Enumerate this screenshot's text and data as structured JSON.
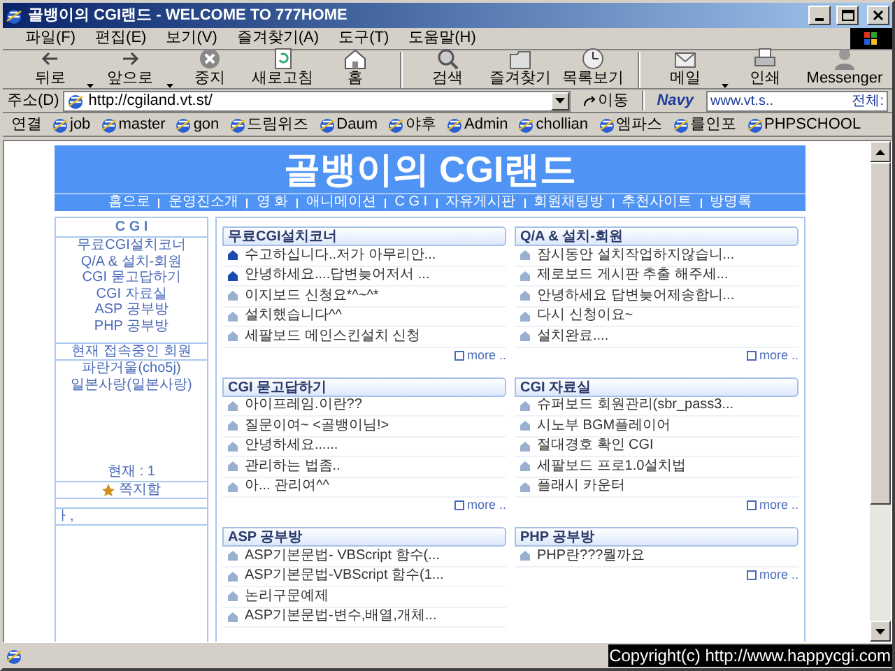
{
  "window": {
    "title": "골뱅이의 CGI랜드 - WELCOME TO 777HOME"
  },
  "menu": [
    "파일(F)",
    "편집(E)",
    "보기(V)",
    "즐겨찾기(A)",
    "도구(T)",
    "도움말(H)"
  ],
  "toolbar": [
    {
      "label": "뒤로",
      "dropdown": true,
      "separator_before": false
    },
    {
      "label": "앞으로",
      "dropdown": true,
      "separator_before": false
    },
    {
      "label": "중지",
      "dropdown": false,
      "separator_before": false
    },
    {
      "label": "새로고침",
      "dropdown": false,
      "separator_before": false
    },
    {
      "label": "홈",
      "dropdown": false,
      "separator_before": false
    },
    {
      "label": "검색",
      "dropdown": false,
      "separator_before": true
    },
    {
      "label": "즐겨찾기",
      "dropdown": false,
      "separator_before": false
    },
    {
      "label": "목록보기",
      "dropdown": false,
      "separator_before": false
    },
    {
      "label": "메일",
      "dropdown": true,
      "separator_before": true
    },
    {
      "label": "인쇄",
      "dropdown": false,
      "separator_before": false
    },
    {
      "label": "Messenger",
      "dropdown": false,
      "separator_before": false
    }
  ],
  "address": {
    "label": "주소(D)",
    "url": "http://cgiland.vt.st/",
    "go": "이동",
    "search_logo": "Navy",
    "search_value": "www.vt.s..",
    "search_scope": "전체:"
  },
  "links": {
    "label": "연결",
    "items": [
      "job",
      "master",
      "gon",
      "드림위즈",
      "Daum",
      "야후",
      "Admin",
      "chollian",
      "엠파스",
      "를인포",
      "PHPSCHOOL"
    ]
  },
  "page": {
    "banner_title": "골뱅이의 CGI랜드",
    "nav": [
      "홈으로",
      "운영진소개",
      "영 화",
      "애니메이션",
      "C G I",
      "자유게시판",
      "회원채팅방",
      "추천사이트",
      "방명록"
    ],
    "sidebar": {
      "cgi_title": "C G I",
      "cgi_links": [
        "무료CGI설치코너",
        "Q/A & 설치-회원",
        "CGI 묻고답하기",
        "CGI 자료실",
        "ASP 공부방",
        "PHP 공부방"
      ],
      "members_title": "현재 접속중인 회원",
      "members": [
        "파란거울(cho5j)",
        "일본사랑(일본사랑)"
      ],
      "count": "현재 : 1",
      "messages": "쪽지함",
      "cut_text": "ㅏ,"
    },
    "boards": [
      {
        "title": "무료CGI설치코너",
        "more": "more ..",
        "items": [
          {
            "text": "수고하십니다..저가 아무리안...",
            "new": true
          },
          {
            "text": "안녕하세요....답변늦어저서 ...",
            "new": true
          },
          {
            "text": "이지보드 신청요*^~^*",
            "new": false
          },
          {
            "text": "설치했습니다^^",
            "new": false
          },
          {
            "text": "세팔보드 메인스킨설치 신청",
            "new": false
          }
        ]
      },
      {
        "title": "Q/A & 설치-회원",
        "more": "more ..",
        "items": [
          {
            "text": "잠시동안 설치작업하지않습니...",
            "new": false
          },
          {
            "text": "제로보드 게시판 추출 해주세...",
            "new": false
          },
          {
            "text": "안녕하세요 답변늦어제송합니...",
            "new": false
          },
          {
            "text": "다시 신청이요~",
            "new": false
          },
          {
            "text": "설치완료....",
            "new": false
          }
        ]
      },
      {
        "title": "CGI 묻고답하기",
        "more": "more ..",
        "items": [
          {
            "text": "아이프레임.이란??",
            "new": false
          },
          {
            "text": "질문이여~ <골뱅이님!>",
            "new": false
          },
          {
            "text": "안녕하세요......",
            "new": false
          },
          {
            "text": "관리하는 법좀..",
            "new": false
          },
          {
            "text": "아... 관리여^^",
            "new": false
          }
        ]
      },
      {
        "title": "CGI 자료실",
        "more": "more ..",
        "items": [
          {
            "text": "슈퍼보드 회원관리(sbr_pass3...",
            "new": false
          },
          {
            "text": "시노부 BGM플레이어",
            "new": false
          },
          {
            "text": "절대경호 확인 CGI",
            "new": false
          },
          {
            "text": "세팔보드 프로1.0설치법",
            "new": false
          },
          {
            "text": "플래시 카운터",
            "new": false
          }
        ]
      },
      {
        "title": "ASP 공부방",
        "items": [
          {
            "text": "ASP기본문법- VBScript 함수(...",
            "new": false
          },
          {
            "text": "ASP기본문법-VBScript 함수(1...",
            "new": false
          },
          {
            "text": "논리구문예제",
            "new": false
          },
          {
            "text": "ASP기본문법-변수,배열,개체...",
            "new": false
          }
        ]
      },
      {
        "title": "PHP 공부방",
        "more": "more ..",
        "items": [
          {
            "text": "PHP란???뭘까요",
            "new": false
          }
        ]
      }
    ]
  },
  "status_bar": {
    "copyright": "Copyright(c) http://www.happycgi.com"
  }
}
